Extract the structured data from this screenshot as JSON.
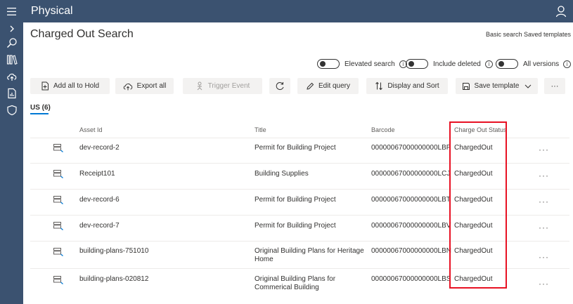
{
  "app": {
    "title": "Physical"
  },
  "page": {
    "title": "Charged Out Search",
    "links": {
      "basic_search": "Basic search",
      "saved_templates": "Saved templates"
    }
  },
  "toggles": [
    {
      "label": "Elevated search",
      "on": false
    },
    {
      "label": "Include deleted",
      "on": false
    },
    {
      "label": "All versions",
      "on": false
    }
  ],
  "toolbar": {
    "add_all_to_hold": "Add all to Hold",
    "export_all": "Export all",
    "trigger_event": "Trigger Event",
    "edit_query": "Edit query",
    "display_and_sort": "Display and Sort",
    "save_template": "Save template",
    "more": "···"
  },
  "tabs": [
    {
      "label": "US (6)",
      "selected": true
    }
  ],
  "table": {
    "columns": [
      "Asset Id",
      "Title",
      "Barcode",
      "Charge Out Status"
    ],
    "rows": [
      {
        "asset_id": "dev-record-2",
        "title_1": "Permit for Building Project",
        "title_2": "",
        "barcode": "00000067000000000LBP",
        "status": "ChargedOut",
        "more": "···"
      },
      {
        "asset_id": "Receipt101",
        "title_1": "Building Supplies",
        "title_2": "",
        "barcode": "00000067000000000LCJ",
        "status": "ChargedOut",
        "more": "···"
      },
      {
        "asset_id": "dev-record-6",
        "title_1": "Permit for Building Project",
        "title_2": "",
        "barcode": "00000067000000000LBT",
        "status": "ChargedOut",
        "more": "···"
      },
      {
        "asset_id": "dev-record-7",
        "title_1": "Permit for Building Project",
        "title_2": "",
        "barcode": "00000067000000000LBV",
        "status": "ChargedOut",
        "more": "···"
      },
      {
        "asset_id": "building-plans-751010",
        "title_1": "Original Building Plans for Heritage",
        "title_2": "Home",
        "barcode": "00000067000000000LBN",
        "status": "ChargedOut",
        "more": "···"
      },
      {
        "asset_id": "building-plans-020812",
        "title_1": "Original Building Plans for",
        "title_2": "Commerical Building",
        "barcode": "00000067000000000LBS",
        "status": "ChargedOut",
        "more": "···"
      }
    ]
  },
  "colors": {
    "nav_bg": "#3b5270",
    "accent": "#0078d4",
    "highlight": "#e81123"
  }
}
